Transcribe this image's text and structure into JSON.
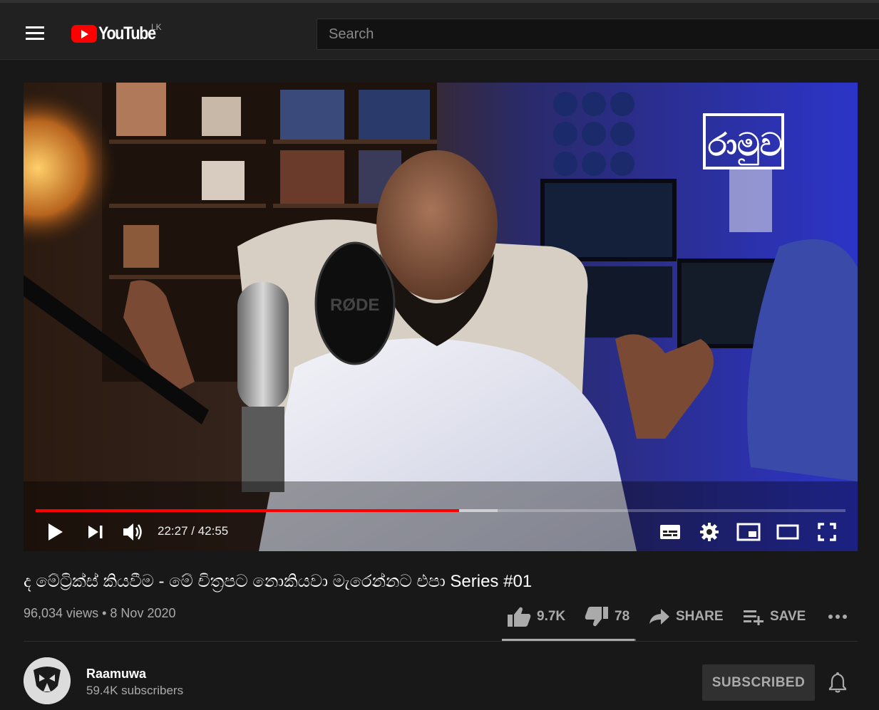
{
  "masthead": {
    "logo_text": "YouTube",
    "country_code": "LK",
    "search_placeholder": "Search"
  },
  "player": {
    "current_time": "22:27",
    "duration": "42:55",
    "time_display": "22:27 / 42:55",
    "progress_fraction": 0.523,
    "buffered_fraction": 0.57,
    "overlay_logo_text": "රාමුව",
    "mic_brand_text": "RØDE"
  },
  "video": {
    "title": "ද මේට්‍රික්ස් කියවීම - මේ චිත්‍රපට නොකියවා මැරෙන්නට එපා Series #01",
    "views": "96,034 views",
    "separator": "•",
    "date": "8 Nov 2020",
    "likes": "9.7K",
    "dislikes": "78",
    "share_label": "SHARE",
    "save_label": "SAVE",
    "like_fraction": 0.99
  },
  "channel": {
    "name": "Raamuwa",
    "subscribers": "59.4K subscribers",
    "subscribe_label": "SUBSCRIBED"
  },
  "colors": {
    "accent": "#ff0000",
    "background": "#181818",
    "masthead": "#212121",
    "secondary_text": "#aaaaaa"
  }
}
